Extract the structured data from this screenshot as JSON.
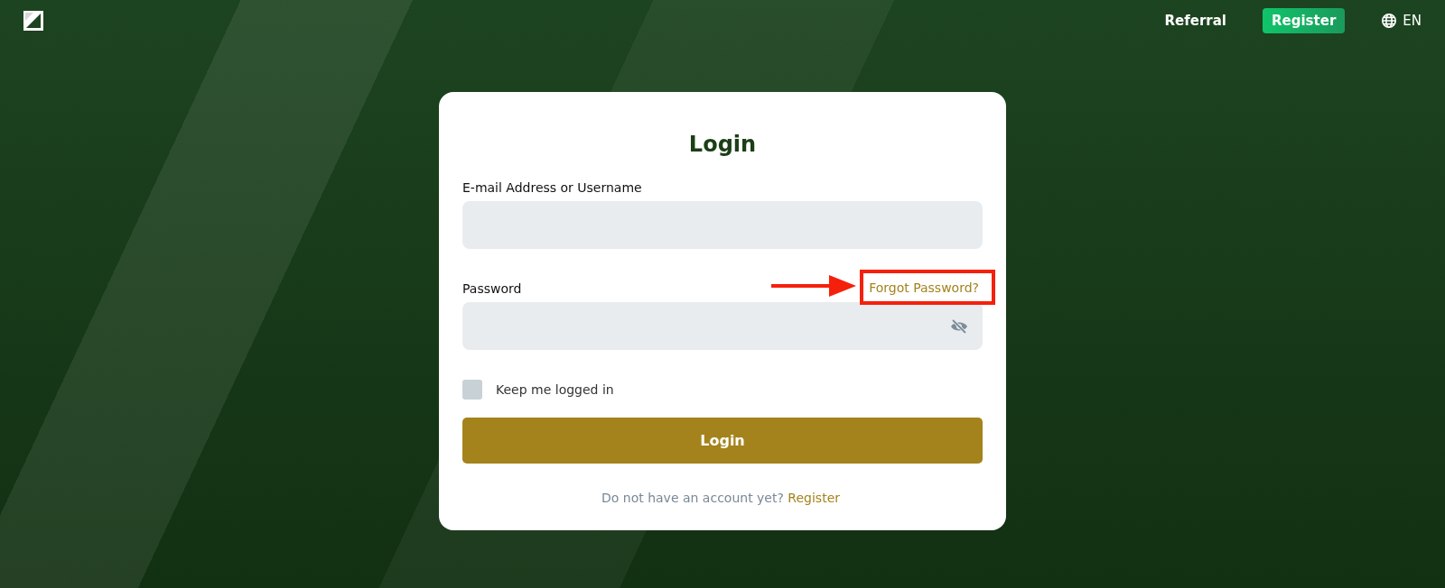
{
  "header": {
    "nav": [
      {
        "label": "Referral",
        "kind": "link"
      },
      {
        "label": "Register",
        "kind": "button"
      }
    ],
    "language": "EN"
  },
  "login": {
    "title": "Login",
    "fields": [
      {
        "label": "E-mail Address or Username",
        "kind": "text"
      },
      {
        "label": "Password",
        "kind": "password",
        "password_visible": false,
        "link": {
          "label": "Forgot Password?",
          "highlighted": true
        }
      }
    ],
    "remember": {
      "label": "Keep me logged in",
      "checked": false
    },
    "submit": "Login",
    "footer": {
      "text": "Do not have an account yet?",
      "link": "Register"
    }
  }
}
